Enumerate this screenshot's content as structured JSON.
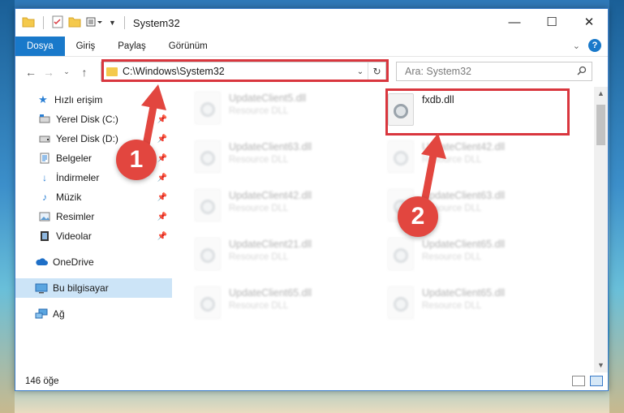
{
  "window": {
    "title": "System32",
    "controls": {
      "minimize": "—",
      "maximize": "☐",
      "close": "✕"
    }
  },
  "ribbon": {
    "tabs": [
      {
        "label": "Dosya"
      },
      {
        "label": "Giriş"
      },
      {
        "label": "Paylaş"
      },
      {
        "label": "Görünüm"
      }
    ],
    "help": "?"
  },
  "address_bar": {
    "path": "C:\\Windows\\System32"
  },
  "search": {
    "placeholder": "Ara: System32"
  },
  "sidebar": {
    "quick_access": "Hızlı erişim",
    "items": [
      {
        "label": "Yerel Disk (C:)",
        "icon": "drive-icon"
      },
      {
        "label": "Yerel Disk (D:)",
        "icon": "drive-icon"
      },
      {
        "label": "Belgeler",
        "icon": "documents-icon"
      },
      {
        "label": "İndirmeler",
        "icon": "downloads-icon"
      },
      {
        "label": "Müzik",
        "icon": "music-icon"
      },
      {
        "label": "Resimler",
        "icon": "pictures-icon"
      },
      {
        "label": "Videolar",
        "icon": "videos-icon"
      }
    ],
    "onedrive": "OneDrive",
    "this_pc": "Bu bilgisayar",
    "network": "Ağ"
  },
  "files": {
    "left": [
      {
        "name": "UpdateClient5.dll",
        "type": "Resource DLL"
      },
      {
        "name": "UpdateClient63.dll",
        "type": "Resource DLL"
      },
      {
        "name": "UpdateClient42.dll",
        "type": "Resource DLL"
      },
      {
        "name": "UpdateClient21.dll",
        "type": "Resource DLL"
      },
      {
        "name": "UpdateClient65.dll",
        "type": "Resource DLL"
      }
    ],
    "right": [
      {
        "name": "fxdb.dll",
        "type": ""
      },
      {
        "name": "UpdateClient42.dll",
        "type": "Resource DLL"
      },
      {
        "name": "UpdateClient63.dll",
        "type": "Resource DLL"
      },
      {
        "name": "UpdateClient65.dll",
        "type": "Resource DLL"
      },
      {
        "name": "UpdateClient65.dll",
        "type": "Resource DLL"
      }
    ]
  },
  "status": {
    "item_count": "146 öğe"
  },
  "annotations": {
    "step1": "1",
    "step2": "2",
    "color": "#e2463f"
  }
}
